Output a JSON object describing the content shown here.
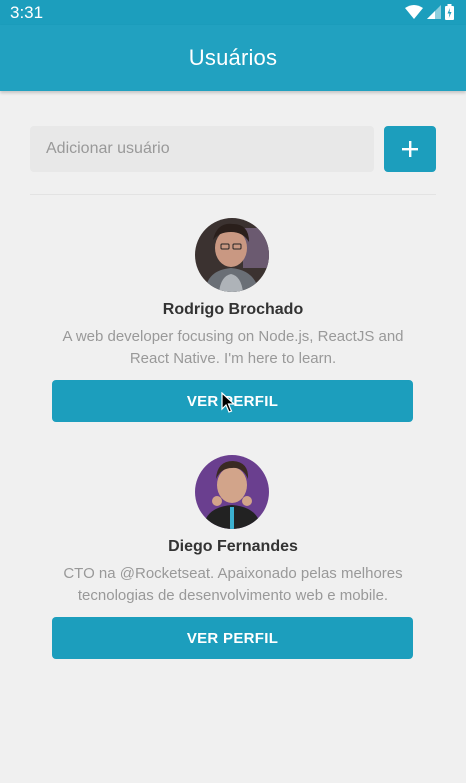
{
  "status_bar": {
    "time": "3:31"
  },
  "app_bar": {
    "title": "Usuários"
  },
  "search": {
    "placeholder": "Adicionar usuário",
    "value": ""
  },
  "add_button": {
    "icon": "plus-icon",
    "label": "+"
  },
  "users": [
    {
      "name": "Rodrigo Brochado",
      "bio": "A web developer focusing on Node.js, ReactJS and React Native. I'm here to learn.",
      "button_label": "VER PERFIL"
    },
    {
      "name": "Diego Fernandes",
      "bio": "CTO na @Rocketseat. Apaixonado pelas melhores tecnologias de desenvolvimento web e mobile.",
      "button_label": "VER PERFIL"
    }
  ],
  "colors": {
    "primary": "#21a1c0",
    "status_bar": "#1c9ebd",
    "background": "#f0f0f0"
  }
}
